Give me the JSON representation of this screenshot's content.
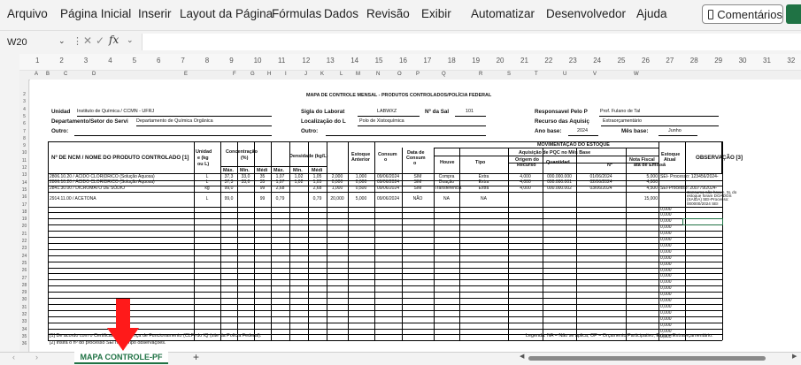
{
  "menu": [
    "Arquivo",
    "Página Inicial",
    "Inserir",
    "Layout da Página",
    "Fórmulas",
    "Dados",
    "Revisão",
    "Exibir",
    "Automatizar",
    "Desenvolvedor",
    "Ajuda"
  ],
  "comments_label": "Comentários",
  "name_box": "W20",
  "fx_label": "fx",
  "ruler_numbers": [
    "1",
    "2",
    "3",
    "4",
    "5",
    "6",
    "7",
    "8",
    "9",
    "10",
    "11",
    "12",
    "13",
    "14",
    "15",
    "16",
    "17",
    "18",
    "19",
    "20",
    "21",
    "22",
    "23",
    "24",
    "25",
    "26",
    "27",
    "28",
    "29",
    "30",
    "31",
    "32"
  ],
  "column_letters": [
    "A",
    "B",
    "C",
    "D",
    "E",
    "F",
    "G",
    "H",
    "I",
    "J",
    "K",
    "L",
    "M",
    "N",
    "O",
    "P",
    "Q",
    "R",
    "S",
    "T",
    "U",
    "V",
    "W"
  ],
  "row_numbers": [
    "2",
    "3",
    "4",
    "5",
    "6",
    "7",
    "8",
    "9",
    "10",
    "11",
    "12",
    "13",
    "14",
    "15",
    "16",
    "17",
    "18",
    "19",
    "20",
    "21",
    "22",
    "23",
    "24",
    "25",
    "26",
    "27",
    "28",
    "29",
    "30",
    "31",
    "32",
    "33",
    "34",
    "35",
    "36"
  ],
  "doc": {
    "title": "MAPA DE CONTROLE MENSAL - PRODUTOS CONTROLADOS/POLÍCIA FEDERAL",
    "unidade_label": "Unidad",
    "unidade_value": "Instituto de Química / CCMN - UFRJ",
    "depto_label": "Departamento/Setor do Servi",
    "depto_value": "Departamento de Química Orgânica",
    "outro1_label": "Outro:",
    "sigla_label": "Sigla do Laborat",
    "sigla_value": "LABWXZ",
    "sala_label": "Nº da Sal",
    "sala_value": "101",
    "local_label": "Localização do L",
    "local_value": "Polo de Xistoquímica",
    "outro2_label": "Outro:",
    "resp_label": "Responsavel Pelo P",
    "resp_value": "Prof. Fulano de Tal",
    "recurso_label": "Recurso das Aquisiç",
    "recurso_value": "Extraorçamentário",
    "ano_label": "Ano base:",
    "ano_value": "2024",
    "mes_label": "Mês base:",
    "mes_value": "Junho"
  },
  "headers": {
    "ncm": "Nº DE NCM / NOME DO PRODUTO CONTROLADO [1]",
    "unid1": "Unidad",
    "unid2": "e (kg",
    "unid3": "ou L)",
    "conc": "Concentração",
    "conc_pct": "(%)",
    "dens": "Densidade (kg/L)",
    "max": "Máx.",
    "min": "Mín.",
    "med": "Médi",
    "estoque_ant1": "Estoque",
    "estoque_ant2": "Anterior",
    "consumo1": "Consum",
    "consumo2": "o",
    "data1": "Data de",
    "data2": "Consum",
    "data3": "o",
    "mov": "MOVIMENTAÇÃO DO ESTOQUE",
    "aquis": "Aquisição de PQC no Mês Base",
    "houve": "Houve",
    "tipo": "Tipo",
    "origem1": "Origem do",
    "origem2": "Recurso",
    "quantidade": "Quantidad",
    "nota": "Nota Fiscal",
    "nota_n": "Nº",
    "nota_data": "ata de Emissã",
    "estoque_at1": "Estoque",
    "estoque_at2": "Atual",
    "obs": "OBSERVAÇÃO [3]"
  },
  "rows": [
    {
      "produto": "2806.10.20 / ÁCIDO CLORÍDRICO (Solução Aquosa)",
      "unid": "L",
      "cmax": "37,3",
      "cmin": "33,0",
      "cmed": "35",
      "dmax": "1,07",
      "dmin": "1,02",
      "dmed": "1,05",
      "est_ant": "2,000",
      "consumo": "1,000",
      "data": "09/06/2024",
      "houve": "SIM",
      "tipo": "Compra",
      "origem": "Extra",
      "qtd": "4,000",
      "nf": "000.000.000",
      "nf_data": "01/06/2024",
      "est_at": "5,000",
      "obs": "SEI- Processo: 123456/2024-"
    },
    {
      "produto": "2806.10.20 / ÁCIDO CLORÍDRICO (Solução Aquosa)",
      "unid": "L",
      "cmax": "37,3",
      "cmin": "33,0",
      "cmed": "35",
      "dmax": "1,07",
      "dmin": "1,02",
      "dmed": "1,05",
      "est_ant": "0,000",
      "consumo": "0,000",
      "data": "09/06/2024",
      "houve": "SIM",
      "tipo": "Doação",
      "origem": "Extra",
      "qtd": "4,000",
      "nf": "000.000.001",
      "nf_data": "02/06/2024",
      "est_at": "4,000",
      "obs": ""
    },
    {
      "produto": "2841.30.00 / DICROMATO DE SÓDIO",
      "unid": "kg",
      "cmax": "99,0",
      "cmin": "",
      "cmed": "99",
      "dmax": "2,68",
      "dmin": "",
      "dmed": "2,68",
      "est_ant": "1,000",
      "consumo": "0,500",
      "data": "09/06/2024",
      "houve": "SIM",
      "tipo": "Transferência",
      "origem": "Extra",
      "qtd": "4,000",
      "nf": "000.000.002",
      "nf_data": "03/06/2024",
      "est_at": "4,500",
      "obs": "SEI-Processo: 200779/2024-"
    },
    {
      "produto": "2914.11.00 / ACETONA",
      "unid": "L",
      "cmax": "99,0",
      "cmin": "",
      "cmed": "99",
      "dmax": "0,79",
      "dmin": "",
      "dmed": "0,79",
      "est_ant": "20,000",
      "consumo": "5,000",
      "data": "09/06/2024",
      "houve": "NÃO",
      "tipo": "NA",
      "origem": "NA",
      "qtd": "",
      "nf": "",
      "nf_data": "",
      "est_at": "15,000",
      "obs": ""
    }
  ],
  "acetona_obs": [
    "Consumo não houve, 5L do",
    "estoque foram DOADOS",
    "(SAÍDA) SEI-Processo:",
    "000000/2024 SEI"
  ],
  "empty_estoque": "0,000",
  "footnote1": "[1] De acordo com o Certificado de Licença de Funcionamento (CLF) do IQ (site da Polícia Federal).",
  "footnote2": "[2] Insira o nº do processo SEI no campo observações.",
  "legend": "Legenda: NA = Não se aplica; OP = Orçamento Participativo; Extra = Extraorçamentário.",
  "sheet_tab": "MAPA CONTROLE-PF",
  "add_sheet": "+"
}
